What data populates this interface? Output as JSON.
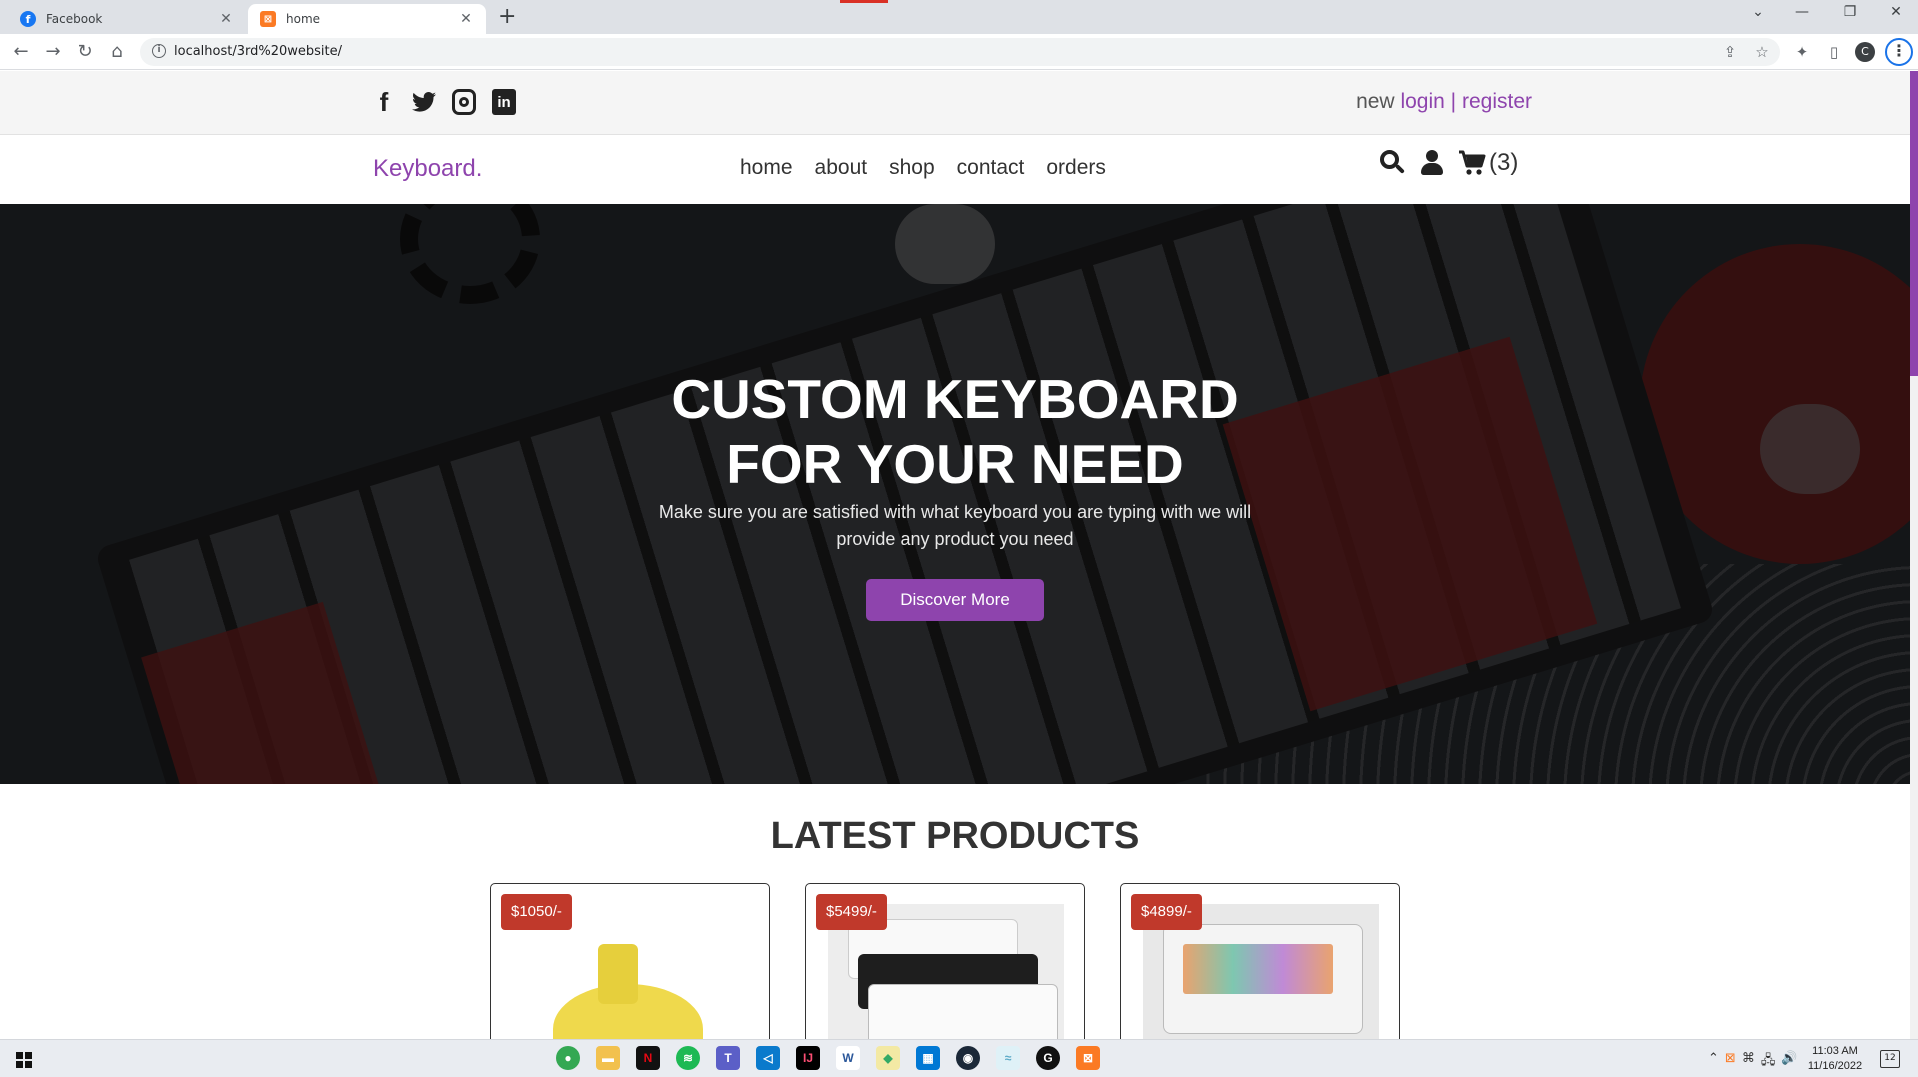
{
  "browser": {
    "tabs": [
      {
        "title": "Facebook",
        "favicon": "facebook-icon",
        "active": false
      },
      {
        "title": "home",
        "favicon": "xampp-icon",
        "active": true
      }
    ],
    "url": "localhost/3rd%20website/",
    "profile_initial": "C"
  },
  "topbar": {
    "social_icons": [
      "facebook-icon",
      "twitter-icon",
      "instagram-icon",
      "linkedin-icon"
    ],
    "auth_prefix": "new",
    "login_label": "login",
    "separator": "|",
    "register_label": "register"
  },
  "header": {
    "logo": "Keyboard.",
    "nav": [
      "home",
      "about",
      "shop",
      "contact",
      "orders"
    ],
    "cart_count": "(3)"
  },
  "hero": {
    "title_line1": "CUSTOM KEYBOARD",
    "title_line2": "FOR YOUR NEED",
    "subtitle": "Make sure you are satisfied with what keyboard you are typing with we will provide any product you need",
    "button_label": "Discover More"
  },
  "latest": {
    "title": "LATEST PRODUCTS",
    "products": [
      {
        "price": "$1050/-",
        "image": "yellow-switch"
      },
      {
        "price": "$5499/-",
        "image": "stacked-keyboards"
      },
      {
        "price": "$4899/-",
        "image": "artisan-keyboard"
      }
    ]
  },
  "taskbar": {
    "time": "11:03 AM",
    "date": "11/16/2022",
    "notifications": "12"
  },
  "colors": {
    "accent": "#8e44ad",
    "price_badge": "#c0392b"
  }
}
